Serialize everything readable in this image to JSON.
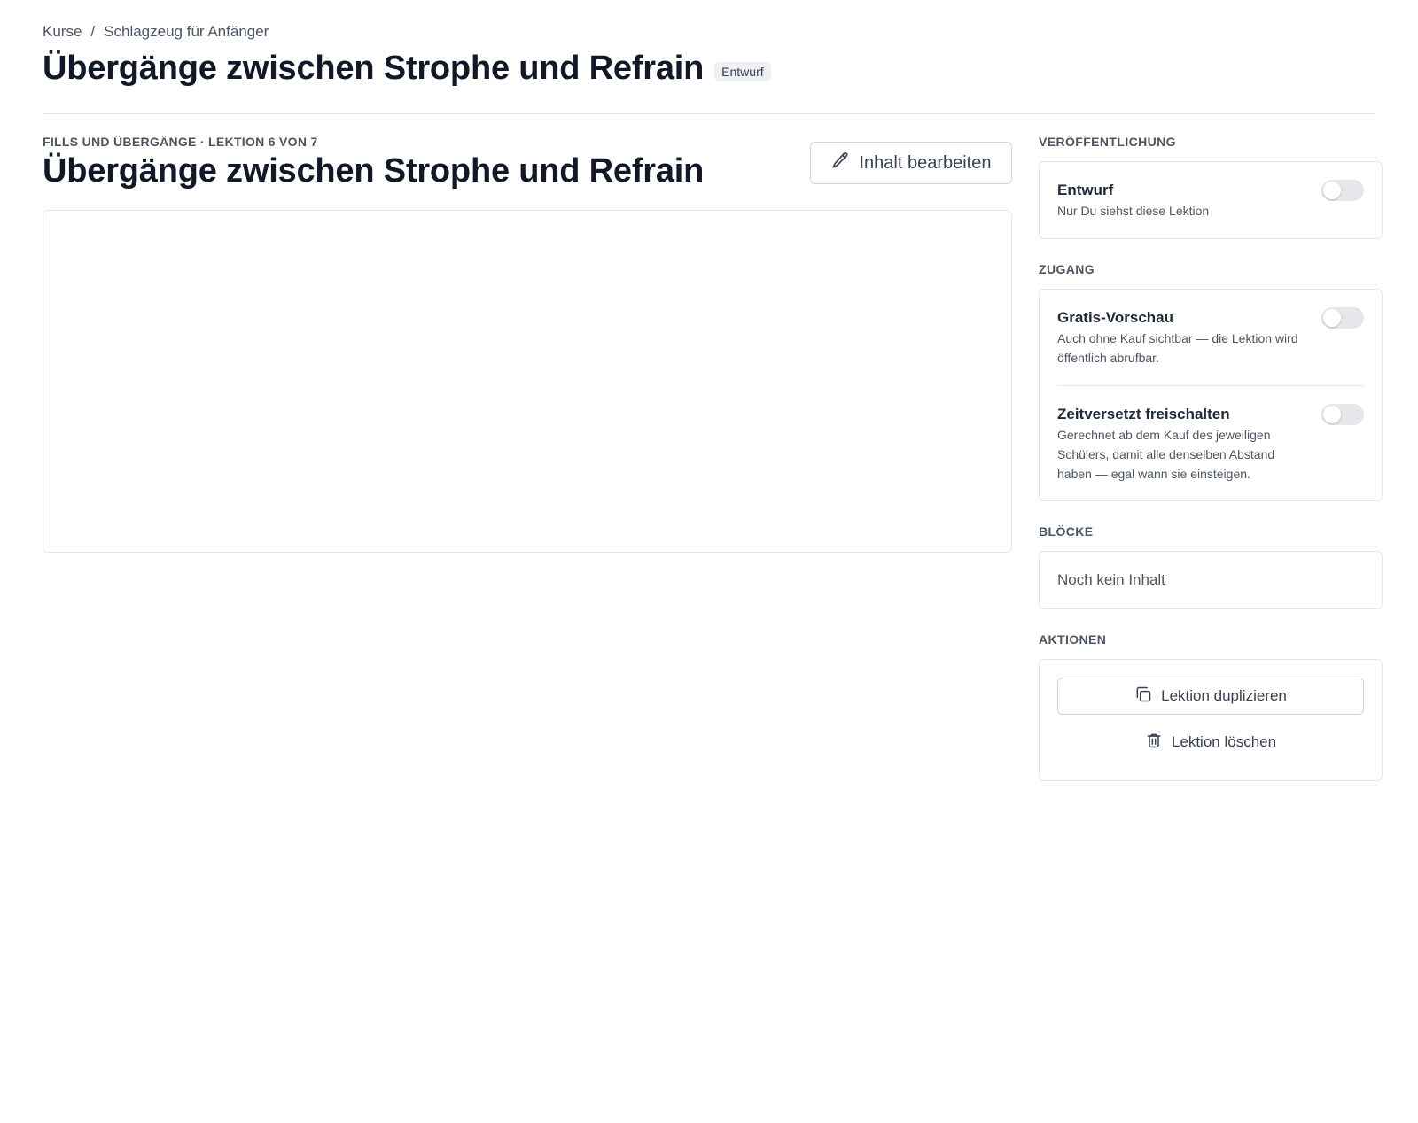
{
  "breadcrumb": {
    "items": [
      "Kurse",
      "Schlagzeug für Anfänger"
    ],
    "separator": "/"
  },
  "header": {
    "title": "Übergänge zwischen Strophe und Refrain",
    "status_badge": "Entwurf"
  },
  "lesson": {
    "meta": "FILLS UND ÜBERGÄNGE · LEKTION 6 VON 7",
    "title": "Übergänge zwischen Strophe und Refrain",
    "edit_label": "Inhalt bearbeiten"
  },
  "sidebar": {
    "publishing": {
      "heading": "VERÖFFENTLICHUNG",
      "draft": {
        "title": "Entwurf",
        "description": "Nur Du siehst diese Lektion",
        "enabled": false
      }
    },
    "access": {
      "heading": "ZUGANG",
      "free_preview": {
        "title": "Gratis-Vorschau",
        "description": "Auch ohne Kauf sichtbar — die Lektion wird öffentlich abrufbar.",
        "enabled": false
      },
      "drip": {
        "title": "Zeitversetzt freischalten",
        "description": "Gerechnet ab dem Kauf des jeweiligen Schülers, damit alle denselben Abstand haben — egal wann sie einsteigen.",
        "enabled": false
      }
    },
    "blocks": {
      "heading": "BLÖCKE",
      "empty_text": "Noch kein Inhalt"
    },
    "actions": {
      "heading": "AKTIONEN",
      "duplicate_label": "Lektion duplizieren",
      "delete_label": "Lektion löschen"
    }
  },
  "icons": {
    "edit": "pencil-icon",
    "duplicate": "copy-icon",
    "delete": "trash-icon"
  },
  "colors": {
    "text_primary": "#111827",
    "text_secondary": "#4b5563",
    "border": "#e5e7eb",
    "toggle_off": "#e5e7eb",
    "badge_bg": "#eef0f4"
  }
}
